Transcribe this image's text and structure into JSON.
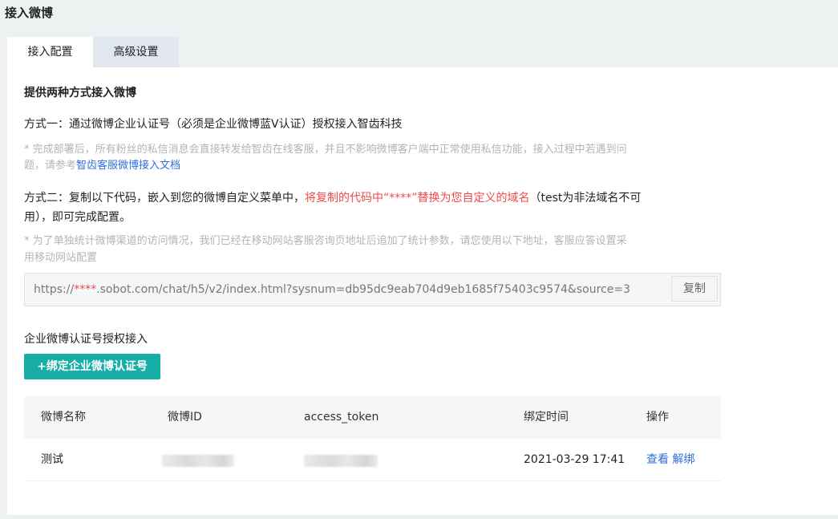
{
  "page_title": "接入微博",
  "tabs": [
    {
      "label": "接入配置",
      "active": true
    },
    {
      "label": "高级设置",
      "active": false
    }
  ],
  "intro": "提供两种方式接入微博",
  "method1": {
    "title": "方式一：通过微博企业认证号（必须是企业微博蓝V认证）授权接入智齿科技",
    "note_line1": "* 完成部署后，所有粉丝的私信消息会直接转发给智齿在线客服，并且不影响微博客户端中正常使用私信功能，接入过程中若遇到问",
    "note_line2_prefix": "题，请参考",
    "doc_link": "智齿客服微博接入文档"
  },
  "method2": {
    "prefix": "方式二：复制以下代码，嵌入到您的微博自定义菜单中，",
    "highlight": "将复制的代码中“****”替换为您自定义的域名",
    "suffix": "（test为非法域名不可",
    "line2": "用），即可完成配置。",
    "note_line1": "* 为了单独统计微博渠道的访问情况，我们已经在移动网站客服咨询页地址后追加了统计参数，请您使用以下地址，客服应答设置采",
    "note_line2": "用移动网站配置"
  },
  "url": {
    "prefix": "https://",
    "masked": "****",
    "rest": ".sobot.com/chat/h5/v2/index.html?sysnum=db95dc9eab704d9eb1685f75403c9574&source=3",
    "copy_label": "复制"
  },
  "section2_title": "企业微博认证号授权接入",
  "bind_button": "+绑定企业微博认证号",
  "table": {
    "headers": [
      "微博名称",
      "微博ID",
      "access_token",
      "绑定时间",
      "操作"
    ],
    "rows": [
      {
        "name": "测试",
        "bind_time": "2021-03-29 17:41",
        "view": "查看",
        "unbind": "解绑"
      }
    ]
  },
  "colors": {
    "accent": "#17aea8",
    "link": "#2f6fe0",
    "warning": "#f04a4a"
  }
}
